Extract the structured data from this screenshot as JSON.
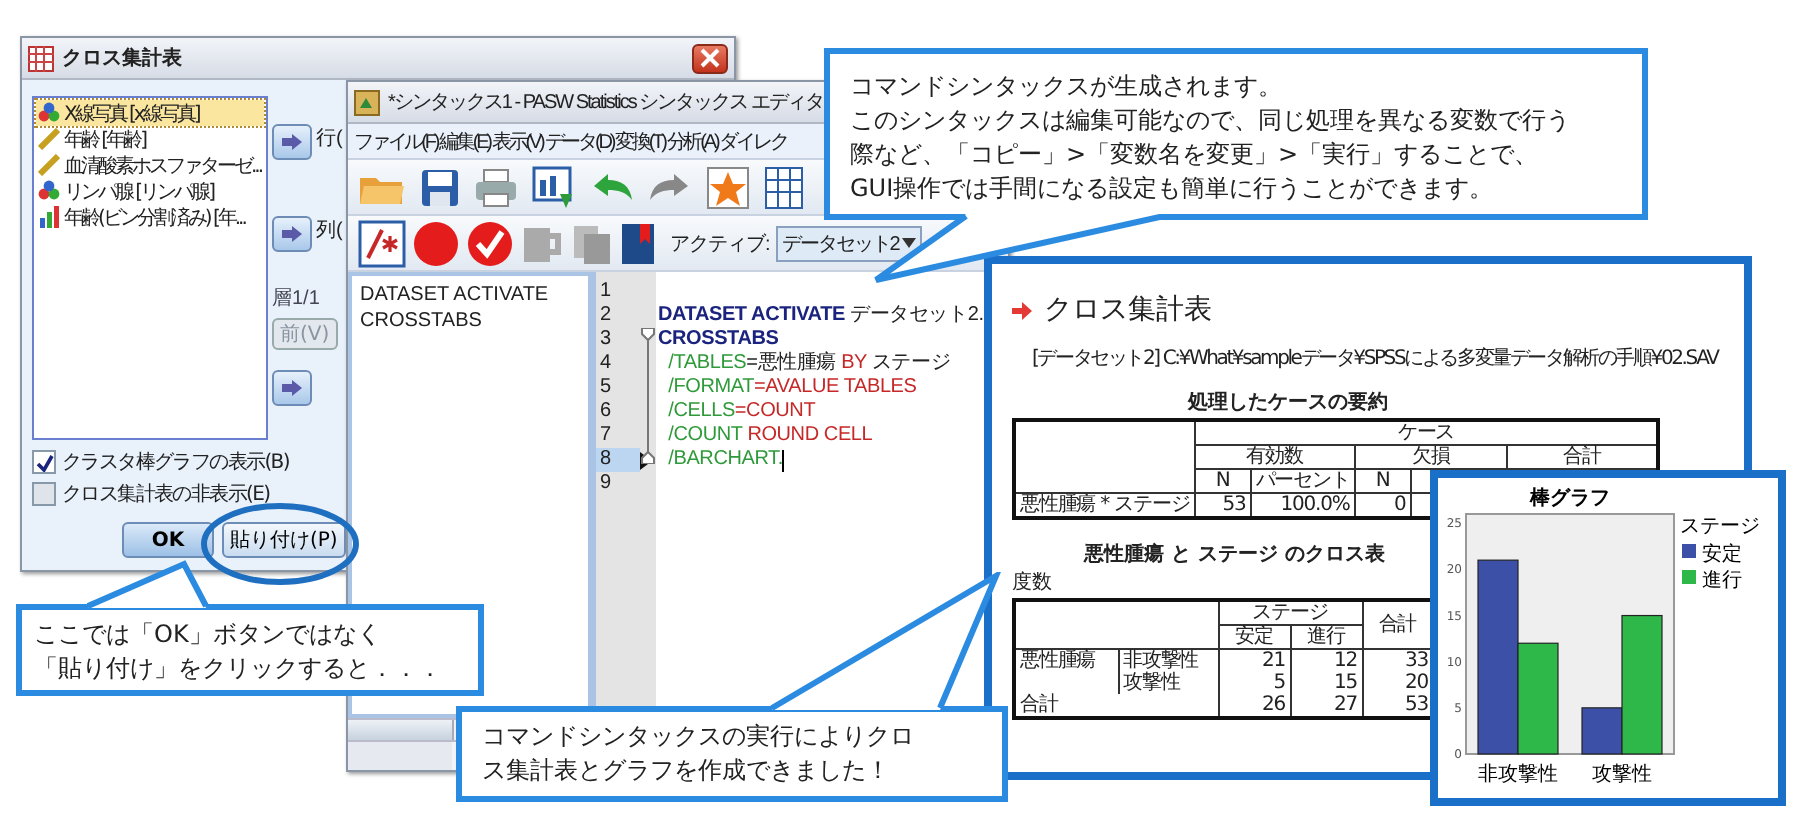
{
  "crosstabs_dialog": {
    "title": "クロス集計表",
    "variables": [
      {
        "label": "X線写真 [x線写真]",
        "kind": "nominal",
        "selected": true
      },
      {
        "label": "年齢 [年齢]",
        "kind": "scale",
        "selected": false
      },
      {
        "label": "血清酸素ホスファターゼ...",
        "kind": "scale",
        "selected": false
      },
      {
        "label": "リンパ腺 [リンパ腺]",
        "kind": "nominal",
        "selected": false
      },
      {
        "label": "年齢(ビン分割済み) [年...",
        "kind": "ordinal",
        "selected": false
      }
    ],
    "row_label": "行(",
    "column_label": "列(",
    "layer_label": "層1/1",
    "previous_button": {
      "label": "前(V)",
      "disabled": true
    },
    "checkboxes": [
      {
        "label": "クラスタ棒グラフの表示(B)",
        "checked": true
      },
      {
        "label": "クロス集計表の非表示(E)",
        "checked": false
      }
    ],
    "buttons": [
      {
        "label": "OK",
        "kind": "default"
      },
      {
        "label": "貼り付け(P)",
        "kind": "normal"
      }
    ]
  },
  "syntax_editor": {
    "title": "*シンタックス1 - PASW Statistics シンタックス エディタ",
    "menu": [
      "ファイル(F)",
      "編集(E)",
      "表示(V)",
      "データ(D)",
      "変換(T)",
      "分析(A)",
      "ダイレク"
    ],
    "active_label": "アクティブ:",
    "active_dataset": "データセット2",
    "navigator": [
      "DATASET ACTIVATE",
      "CROSSTABS"
    ],
    "lines": [
      {
        "number": "1",
        "selected": false
      },
      {
        "number": "2",
        "selected": false,
        "tokens": [
          {
            "text": "DATASET ACTIVATE",
            "kind": "command"
          },
          {
            "text": " データセット2.",
            "kind": "plain"
          }
        ]
      },
      {
        "number": "3",
        "selected": false,
        "tokens": [
          {
            "text": "CROSSTABS",
            "kind": "command"
          }
        ]
      },
      {
        "number": "4",
        "selected": false,
        "tokens": [
          {
            "text": "  /TABLES",
            "kind": "subcommand"
          },
          {
            "text": "=悪性腫瘍",
            "kind": "plain"
          },
          {
            "text": " BY",
            "kind": "keyword"
          },
          {
            "text": " ステージ",
            "kind": "plain"
          }
        ]
      },
      {
        "number": "5",
        "selected": false,
        "tokens": [
          {
            "text": "  /FORMAT",
            "kind": "subcommand"
          },
          {
            "text": "=AVALUE TABLES",
            "kind": "keyword"
          }
        ]
      },
      {
        "number": "6",
        "selected": false,
        "tokens": [
          {
            "text": "  /CELLS",
            "kind": "subcommand"
          },
          {
            "text": "=COUNT",
            "kind": "keyword"
          }
        ]
      },
      {
        "number": "7",
        "selected": false,
        "tokens": [
          {
            "text": "  /COUNT",
            "kind": "subcommand"
          },
          {
            "text": " ROUND CELL",
            "kind": "keyword"
          }
        ]
      },
      {
        "number": "8",
        "selected": true,
        "tokens": [
          {
            "text": "  /BARCHART.",
            "kind": "subcommand"
          }
        ]
      },
      {
        "number": "9",
        "selected": false
      }
    ]
  },
  "output": {
    "title": "クロス集計表",
    "dataset_path": "[データセット2] C:¥What¥sampleデータ¥SPSSによる多変量データ解析の手順¥02.SAV",
    "case_summary": {
      "title": "処理したケースの要約",
      "header": "ケース",
      "groups": [
        "有効数",
        "欠損",
        "合計"
      ],
      "subheaders": [
        "N",
        "パーセント",
        "N"
      ],
      "row": {
        "label": "悪性腫瘍 * ステージ",
        "values": [
          "53",
          "100.0%",
          "0"
        ]
      }
    },
    "crosstab": {
      "title": "悪性腫瘍 と ステージ のクロス表",
      "unit": "度数",
      "stage_header": "ステージ",
      "columns": [
        "安定",
        "進行"
      ],
      "total_column": "合計",
      "row_group": "悪性腫瘍",
      "rows": [
        {
          "label": "非攻撃性",
          "values": [
            "21",
            "12",
            "33"
          ]
        },
        {
          "label": "攻撃性",
          "values": [
            "5",
            "15",
            "20"
          ]
        }
      ],
      "total": {
        "label": "合計",
        "values": [
          "26",
          "27",
          "53"
        ]
      }
    }
  },
  "chart_window": {
    "chart_data": {
      "type": "bar",
      "title": "棒グラフ",
      "categories": [
        "非攻撃性",
        "攻撃性"
      ],
      "legend": {
        "title": "ステージ"
      },
      "series": [
        {
          "name": "安定",
          "color": "#3c50a8",
          "values": [
            21,
            5
          ]
        },
        {
          "name": "進行",
          "color": "#2fb84a",
          "values": [
            12,
            15
          ]
        }
      ],
      "ylim": [
        0,
        26
      ],
      "yticks": [
        0,
        5,
        10,
        15,
        20,
        25
      ]
    }
  },
  "note_generated": {
    "lines": [
      "コマンドシンタックスが生成されます。",
      "このシンタックスは編集可能なので、同じ処理を異なる変数で行う",
      "際など、「コピー」>「変数名を変更」>「実行」することで、",
      "GUI操作では手間になる設定も簡単に行うことができます。"
    ]
  },
  "note_paste": {
    "lines": [
      "ここでは「OK」ボタンではなく",
      "「貼り付け」をクリックすると．．．"
    ]
  },
  "note_result": {
    "lines": [
      "コマンドシンタックスの実行によりクロ",
      "ス集計表とグラフを作成できました！"
    ]
  }
}
